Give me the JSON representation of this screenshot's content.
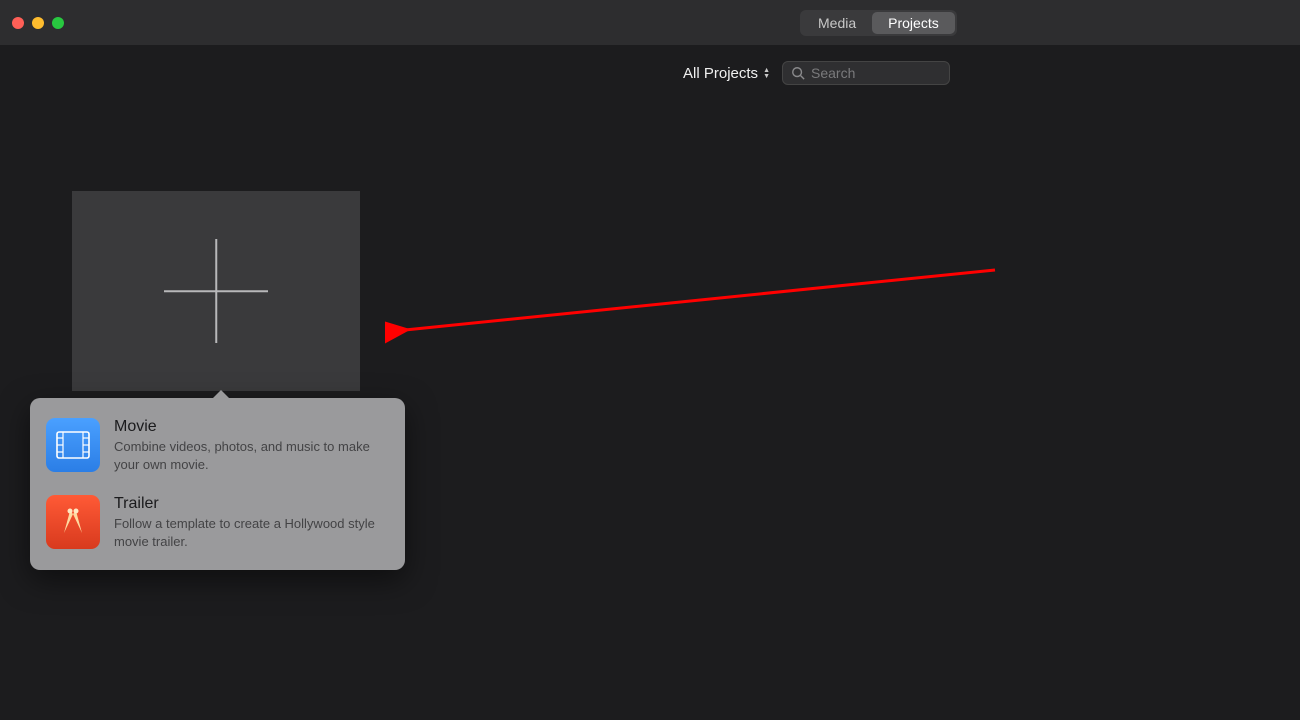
{
  "titlebar": {
    "tabs": {
      "media": "Media",
      "projects": "Projects"
    }
  },
  "toolbar": {
    "filter_label": "All Projects",
    "search_placeholder": "Search"
  },
  "popover": {
    "movie": {
      "title": "Movie",
      "desc": "Combine videos, photos, and music to make your own movie."
    },
    "trailer": {
      "title": "Trailer",
      "desc": "Follow a template to create a Hollywood style movie trailer."
    }
  }
}
